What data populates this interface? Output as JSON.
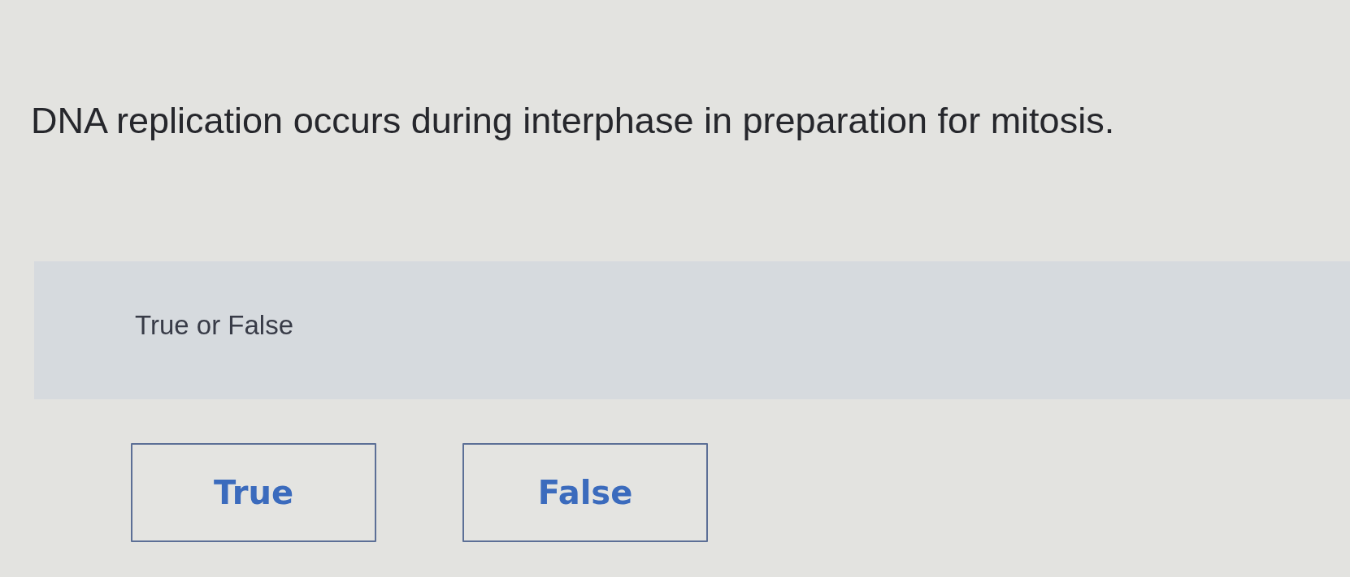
{
  "question": {
    "text": "DNA replication occurs during interphase in preparation for mitosis."
  },
  "prompt_panel": {
    "label": "True or False"
  },
  "options": [
    {
      "label": "True"
    },
    {
      "label": "False"
    }
  ]
}
